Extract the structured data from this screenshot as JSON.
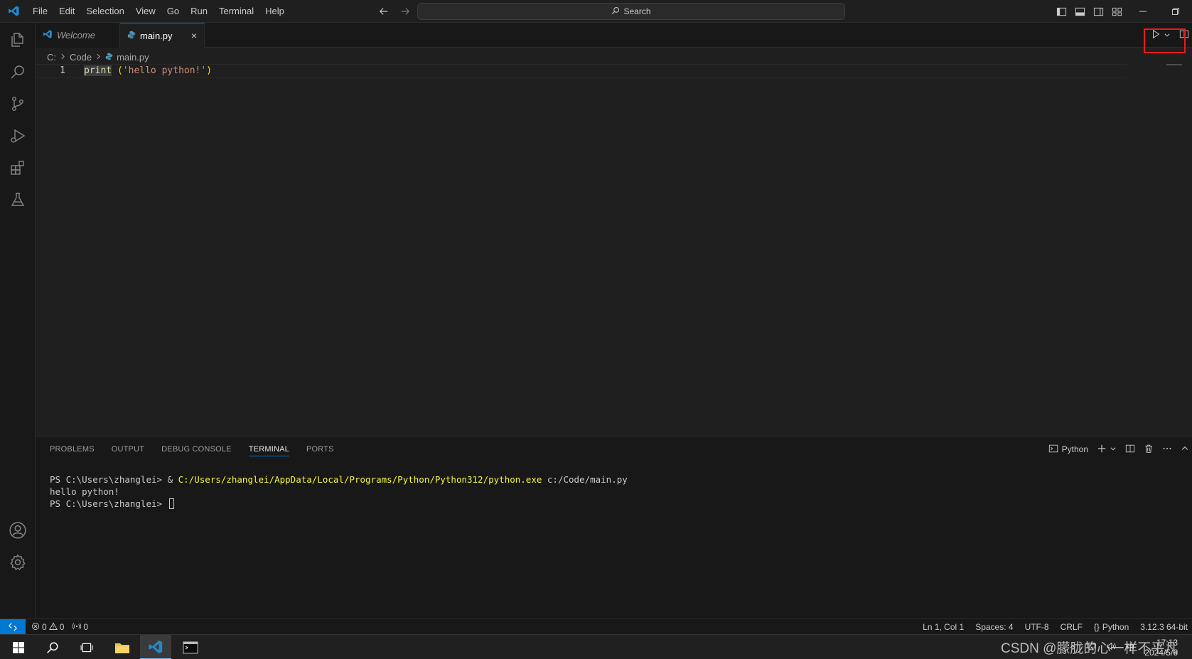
{
  "menu": [
    "File",
    "Edit",
    "Selection",
    "View",
    "Go",
    "Run",
    "Terminal",
    "Help"
  ],
  "search": {
    "label": "Search"
  },
  "tabs": [
    {
      "label": "Welcome",
      "icon": "vscode-icon"
    },
    {
      "label": "main.py",
      "icon": "python-icon",
      "close": "×"
    }
  ],
  "breadcrumb": [
    "C:",
    "Code",
    "main.py"
  ],
  "editor": {
    "line_number": "1",
    "tokens": {
      "fn": "print",
      "space": " ",
      "open": "(",
      "str": "'hello python!'",
      "close": ")"
    }
  },
  "panel": {
    "tabs": [
      "PROBLEMS",
      "OUTPUT",
      "DEBUG CONSOLE",
      "TERMINAL",
      "PORTS"
    ],
    "active_tab": "TERMINAL",
    "terminal_profile": "Python",
    "terminal_lines": {
      "l1_prompt": "PS C:\\Users\\zhanglei> & ",
      "l1_path": "C:/Users/zhanglei/AppData/Local/Programs/Python/Python312/python.exe",
      "l1_arg": " c:/Code/main.py",
      "l2": "hello python!",
      "l3_prompt": "PS C:\\Users\\zhanglei> "
    }
  },
  "statusbar": {
    "errors": "0",
    "warnings": "0",
    "ports": "0",
    "position": "Ln 1, Col 1",
    "spaces": "Spaces: 4",
    "encoding": "UTF-8",
    "eol": "CRLF",
    "language": "Python",
    "interpreter": "3.12.3 64-bit"
  },
  "taskbar": {
    "watermark": "CSDN @朦胧的心一样不平凡",
    "ime": "中",
    "time": "17:13",
    "date": "2024/5/6"
  },
  "colors": {
    "accent": "#0078d4",
    "highlight_box": "#e11d1d",
    "string": "#ce9178",
    "function": "#dcdcaa",
    "terminal_path": "#f5f543"
  }
}
